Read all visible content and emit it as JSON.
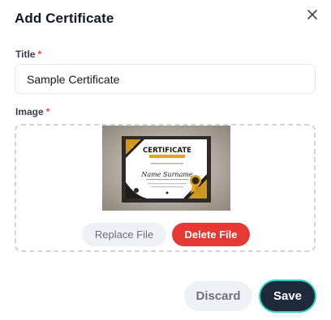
{
  "dialog": {
    "title": "Add Certificate",
    "close_icon": "close-icon"
  },
  "form": {
    "title_field": {
      "label": "Title",
      "required_mark": "*",
      "value": "Sample Certificate"
    },
    "image_field": {
      "label": "Image",
      "required_mark": "*",
      "preview": {
        "heading": "CERTIFICATE",
        "name": "Name Surname"
      },
      "replace_label": "Replace File",
      "delete_label": "Delete File"
    }
  },
  "footer": {
    "discard_label": "Discard",
    "save_label": "Save"
  },
  "colors": {
    "danger": "#e53935",
    "primary": "#1e293b",
    "focus_ring": "#2dd4bf",
    "required": "#ef4444"
  }
}
